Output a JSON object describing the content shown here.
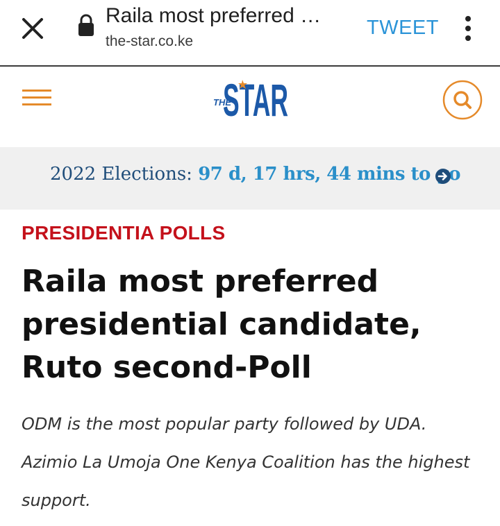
{
  "browser": {
    "tab_title": "Raila most preferred …",
    "url": "the-star.co.ke",
    "tweet_label": "TWEET"
  },
  "site": {
    "logo_text": "STAR",
    "logo_small_text": "THE",
    "brand_color": "#1c59a8",
    "accent_color": "#e58a2a"
  },
  "countdown": {
    "label": "2022 Elections:",
    "value": "97 d, 17 hrs, 44 mins to go"
  },
  "article": {
    "category": "PRESIDENTIA POLLS",
    "headline": "Raila most preferred presidential candidate, Ruto second-Poll",
    "summary": "ODM is the most popular party followed by UDA. Azimio La Umoja One Kenya Coalition has the highest support."
  },
  "icons": {
    "close": "close-icon",
    "lock": "lock-icon",
    "more": "more-vertical-icon",
    "menu": "hamburger-menu-icon",
    "search": "search-icon",
    "arrow": "arrow-right-circle-icon"
  }
}
